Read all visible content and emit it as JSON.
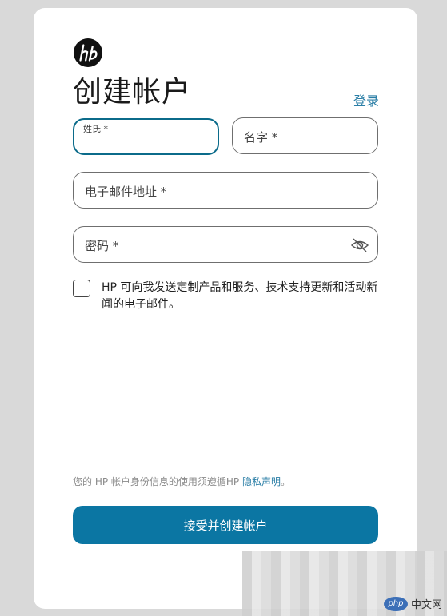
{
  "logo": {
    "icon": "hp-logo-icon"
  },
  "header": {
    "title": "创建帐户",
    "signin_link": "登录"
  },
  "form": {
    "last_name": {
      "label": "姓氏 *",
      "value": ""
    },
    "first_name": {
      "label": "名字 *",
      "value": ""
    },
    "email": {
      "label": "电子邮件地址 *",
      "value": ""
    },
    "password": {
      "label": "密码 *",
      "value": "",
      "toggle_icon": "eye-off-icon"
    },
    "consent": {
      "checked": false,
      "text": "HP 可向我发送定制产品和服务、技术支持更新和活动新闻的电子邮件。"
    }
  },
  "privacy": {
    "prefix": "您的 HP 帐户身份信息的使用须遵循HP ",
    "link": "隐私声明",
    "suffix": "。"
  },
  "submit": {
    "label": "接受并创建帐户"
  },
  "watermark": {
    "badge": "php",
    "text": "中文网"
  },
  "colors": {
    "accent": "#0b76a3",
    "link": "#2a7ea6",
    "focus_border": "#0b6b8a"
  }
}
